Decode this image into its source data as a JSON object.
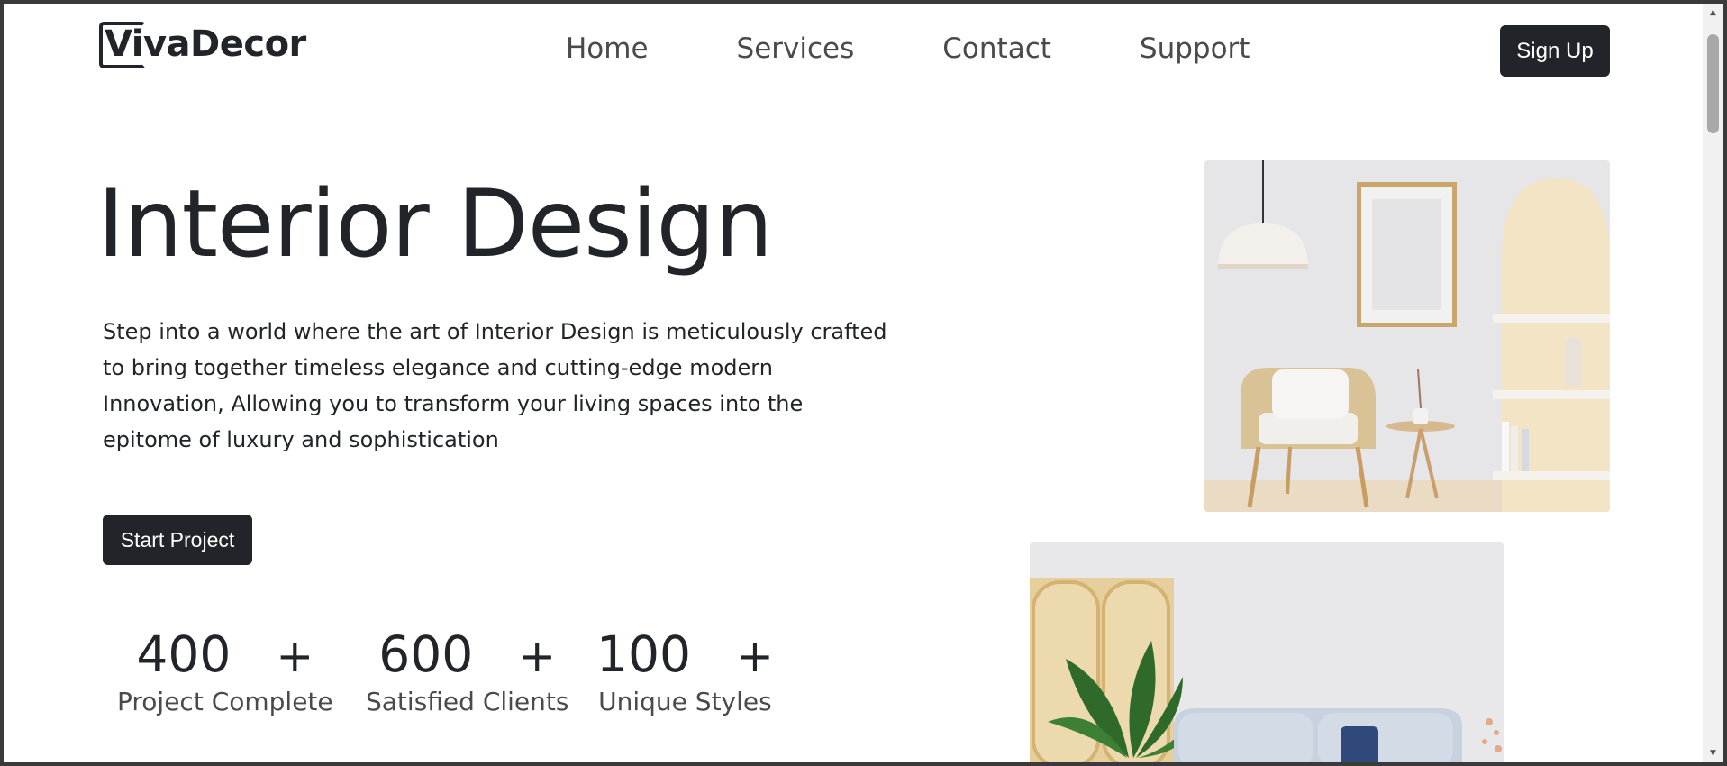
{
  "brand": {
    "name": "VivaDecor"
  },
  "nav": [
    {
      "label": "Home"
    },
    {
      "label": "Services"
    },
    {
      "label": "Contact"
    },
    {
      "label": "Support"
    }
  ],
  "header": {
    "signup_label": "Sign Up"
  },
  "hero": {
    "title": "Interior Design",
    "description": "Step into a world where the art of Interior Design is meticulously crafted to bring together timeless elegance and cutting-edge modern Innovation, Allowing you to transform your living spaces into the epitome of luxury and sophistication",
    "cta_label": "Start Project"
  },
  "stats": [
    {
      "value": "400",
      "suffix": "+",
      "label": "Project Complete"
    },
    {
      "value": "600",
      "suffix": "+",
      "label": "Satisfied Clients"
    },
    {
      "value": "100",
      "suffix": "+",
      "label": "Unique Styles"
    }
  ],
  "colors": {
    "primary_dark": "#212529",
    "nav_text": "#4a4a4a",
    "background": "#ffffff"
  }
}
